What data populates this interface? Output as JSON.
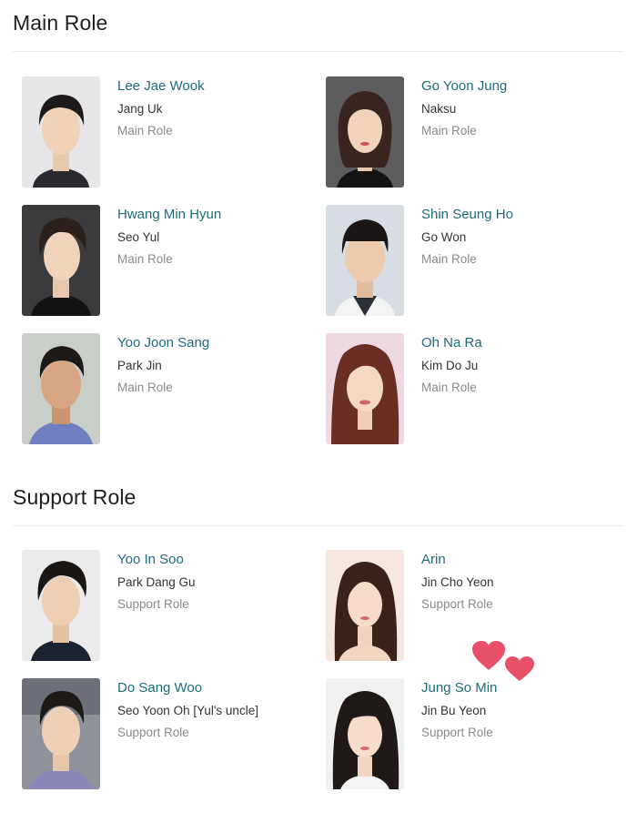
{
  "sections": [
    {
      "title": "Main Role",
      "cast": [
        {
          "name": "Lee Jae Wook",
          "character": "Jang Uk",
          "role": "Main Role",
          "photo_icon": "actor-photo"
        },
        {
          "name": "Go Yoon Jung",
          "character": "Naksu",
          "role": "Main Role",
          "photo_icon": "actress-photo"
        },
        {
          "name": "Hwang Min Hyun",
          "character": "Seo Yul",
          "role": "Main Role",
          "photo_icon": "actor-photo"
        },
        {
          "name": "Shin Seung Ho",
          "character": "Go Won",
          "role": "Main Role",
          "photo_icon": "actor-photo"
        },
        {
          "name": "Yoo Joon Sang",
          "character": "Park Jin",
          "role": "Main Role",
          "photo_icon": "actor-photo"
        },
        {
          "name": "Oh Na Ra",
          "character": "Kim Do Ju",
          "role": "Main Role",
          "photo_icon": "actress-photo"
        }
      ]
    },
    {
      "title": "Support Role",
      "cast": [
        {
          "name": "Yoo In Soo",
          "character": "Park Dang Gu",
          "role": "Support Role",
          "photo_icon": "actor-photo"
        },
        {
          "name": "Arin",
          "character": "Jin Cho Yeon",
          "role": "Support Role",
          "photo_icon": "actress-photo"
        },
        {
          "name": "Do Sang Woo",
          "character": "Seo Yoon Oh [Yul's uncle]",
          "role": "Support Role",
          "photo_icon": "actor-photo"
        },
        {
          "name": "Jung So Min",
          "character": "Jin Bu Yeon",
          "role": "Support Role",
          "photo_icon": "actress-photo"
        }
      ]
    }
  ],
  "decorations": {
    "hearts_icon": "hearts-icon",
    "heart_color": "#e8506a",
    "name_link_color": "#1f6b7a"
  }
}
